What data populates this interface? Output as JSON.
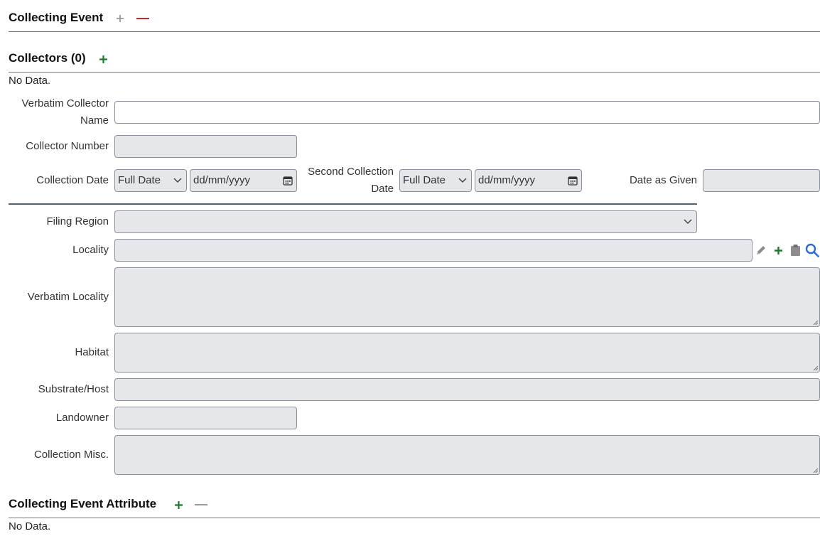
{
  "section_collecting_event": {
    "title": "Collecting Event"
  },
  "section_collectors": {
    "title": "Collectors (0)",
    "no_data": "No Data."
  },
  "fields": {
    "verbatim_collector_name": {
      "label_line1": "Verbatim Collector",
      "label_line2": "Name",
      "value": ""
    },
    "collector_number": {
      "label": "Collector Number",
      "value": ""
    },
    "collection_date": {
      "label": "Collection Date",
      "precision": "Full Date",
      "placeholder": "dd/mm/yyyy"
    },
    "second_collection_date": {
      "label_line1": "Second Collection",
      "label_line2": "Date",
      "precision": "Full Date",
      "placeholder": "dd/mm/yyyy"
    },
    "date_as_given": {
      "label": "Date as Given",
      "value": ""
    },
    "filing_region": {
      "label": "Filing Region",
      "value": ""
    },
    "locality": {
      "label": "Locality",
      "value": ""
    },
    "verbatim_locality": {
      "label": "Verbatim Locality",
      "value": ""
    },
    "habitat": {
      "label": "Habitat",
      "value": ""
    },
    "substrate_host": {
      "label": "Substrate/Host",
      "value": ""
    },
    "landowner": {
      "label": "Landowner",
      "value": ""
    },
    "collection_misc": {
      "label": "Collection Misc.",
      "value": ""
    }
  },
  "section_attribute": {
    "title": "Collecting Event Attribute",
    "no_data": "No Data."
  },
  "colors": {
    "add_green": "#1f7a2e",
    "remove_red": "#c62828",
    "disabled_gray": "#9a9a9a",
    "search_blue": "#2a6ad3"
  },
  "icons": [
    "plus-icon",
    "minus-icon",
    "pencil-icon",
    "clipboard-icon",
    "search-icon",
    "calendar-icon",
    "chevron-down-icon"
  ]
}
